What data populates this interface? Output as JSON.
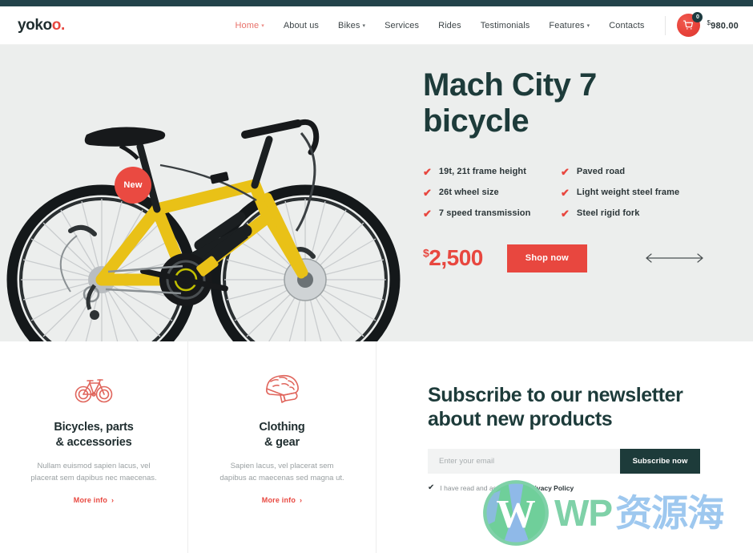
{
  "brand": {
    "logo_main": "yoko",
    "logo_accent": "o."
  },
  "header": {
    "nav": [
      {
        "label": "Home",
        "has_dropdown": true,
        "active": true
      },
      {
        "label": "About us",
        "has_dropdown": false,
        "active": false
      },
      {
        "label": "Bikes",
        "has_dropdown": true,
        "active": false
      },
      {
        "label": "Services",
        "has_dropdown": false,
        "active": false
      },
      {
        "label": "Rides",
        "has_dropdown": false,
        "active": false
      },
      {
        "label": "Testimonials",
        "has_dropdown": false,
        "active": false
      },
      {
        "label": "Features",
        "has_dropdown": true,
        "active": false
      },
      {
        "label": "Contacts",
        "has_dropdown": false,
        "active": false
      }
    ],
    "cart": {
      "icon": "shopping-cart-icon",
      "badge_count": "0",
      "currency": "$",
      "total": "980.00"
    }
  },
  "hero": {
    "badge": "New",
    "product_image_alt": "yellow-hybrid-bicycle",
    "title_line1": "Mach City 7",
    "title_line2": "bicycle",
    "features_left": [
      "19t, 21t frame height",
      "26t wheel size",
      "7 speed transmission"
    ],
    "features_right": [
      "Paved road",
      "Light weight steel frame",
      "Steel rigid fork"
    ],
    "check_icon": "check-icon",
    "price_currency": "$",
    "price": "2,500",
    "shop_button": "Shop now",
    "slider_prev_icon": "arrow-left-icon",
    "slider_next_icon": "arrow-right-icon"
  },
  "cards": [
    {
      "icon": "bicycle-icon",
      "title_line1": "Bicycles, parts",
      "title_line2": "& accessories",
      "desc_line1": "Nullam euismod sapien lacus, vel",
      "desc_line2": "placerat sem dapibus nec maecenas.",
      "link": "More info"
    },
    {
      "icon": "helmet-icon",
      "title_line1": "Clothing",
      "title_line2": "& gear",
      "desc_line1": "Sapien lacus, vel placerat sem",
      "desc_line2": "dapibus ac maecenas sed magna ut.",
      "link": "More info"
    }
  ],
  "newsletter": {
    "title_line1": "Subscribe to our newsletter",
    "title_line2": "about new products",
    "email_placeholder": "Enter your email",
    "email_value": "",
    "submit_label": "Subscribe now",
    "consent_checked": true,
    "consent_text": "I have read and agree to the ",
    "consent_link": "Privacy Policy"
  },
  "watermark": {
    "logo_icon": "wordpress-logo-icon",
    "text_latin": "WP",
    "text_cjk": "资源海"
  },
  "colors": {
    "dark_teal": "#1d3b3a",
    "accent_red": "#e8473f",
    "hero_bg": "#eceeed",
    "topbar": "#23434a"
  }
}
